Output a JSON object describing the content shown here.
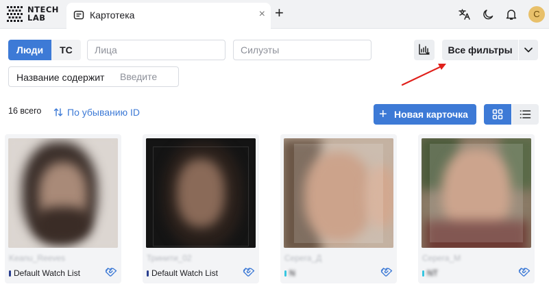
{
  "header": {
    "logo_text": "NTECH\nLAB",
    "tab_title": "Картотека",
    "tab_close": "×",
    "tab_add": "+",
    "avatar_letter": "C",
    "icons": [
      "translate-icon",
      "moon-icon",
      "bell-icon"
    ]
  },
  "filters": {
    "segment": [
      "Люди",
      "ТС"
    ],
    "faces_placeholder": "Лица",
    "silhouettes_placeholder": "Силуэты",
    "name_label": "Название содержит",
    "name_placeholder": "Введите",
    "all_filters_label": "Все фильтры"
  },
  "toolbar": {
    "count": "16 всего",
    "sort_label": "По убыванию ID",
    "new_card_label": "Новая карточка"
  },
  "colors": {
    "accent": "#3d7ad6",
    "arrow": "#e0201b",
    "watchlist_default": "#2a3f8f",
    "watchlist_other": "#37c6e0"
  },
  "cards": [
    {
      "name": "Keanu_Reeves",
      "watch_list": "Default Watch List",
      "dot_color": "#2a3f8f"
    },
    {
      "name": "Тринити_02",
      "watch_list": "Default Watch List",
      "dot_color": "#2a3f8f"
    },
    {
      "name": "Серега_Д",
      "watch_list": "N",
      "dot_color": "#37c6e0"
    },
    {
      "name": "Серега_М",
      "watch_list": "NT",
      "dot_color": "#37c6e0"
    }
  ]
}
